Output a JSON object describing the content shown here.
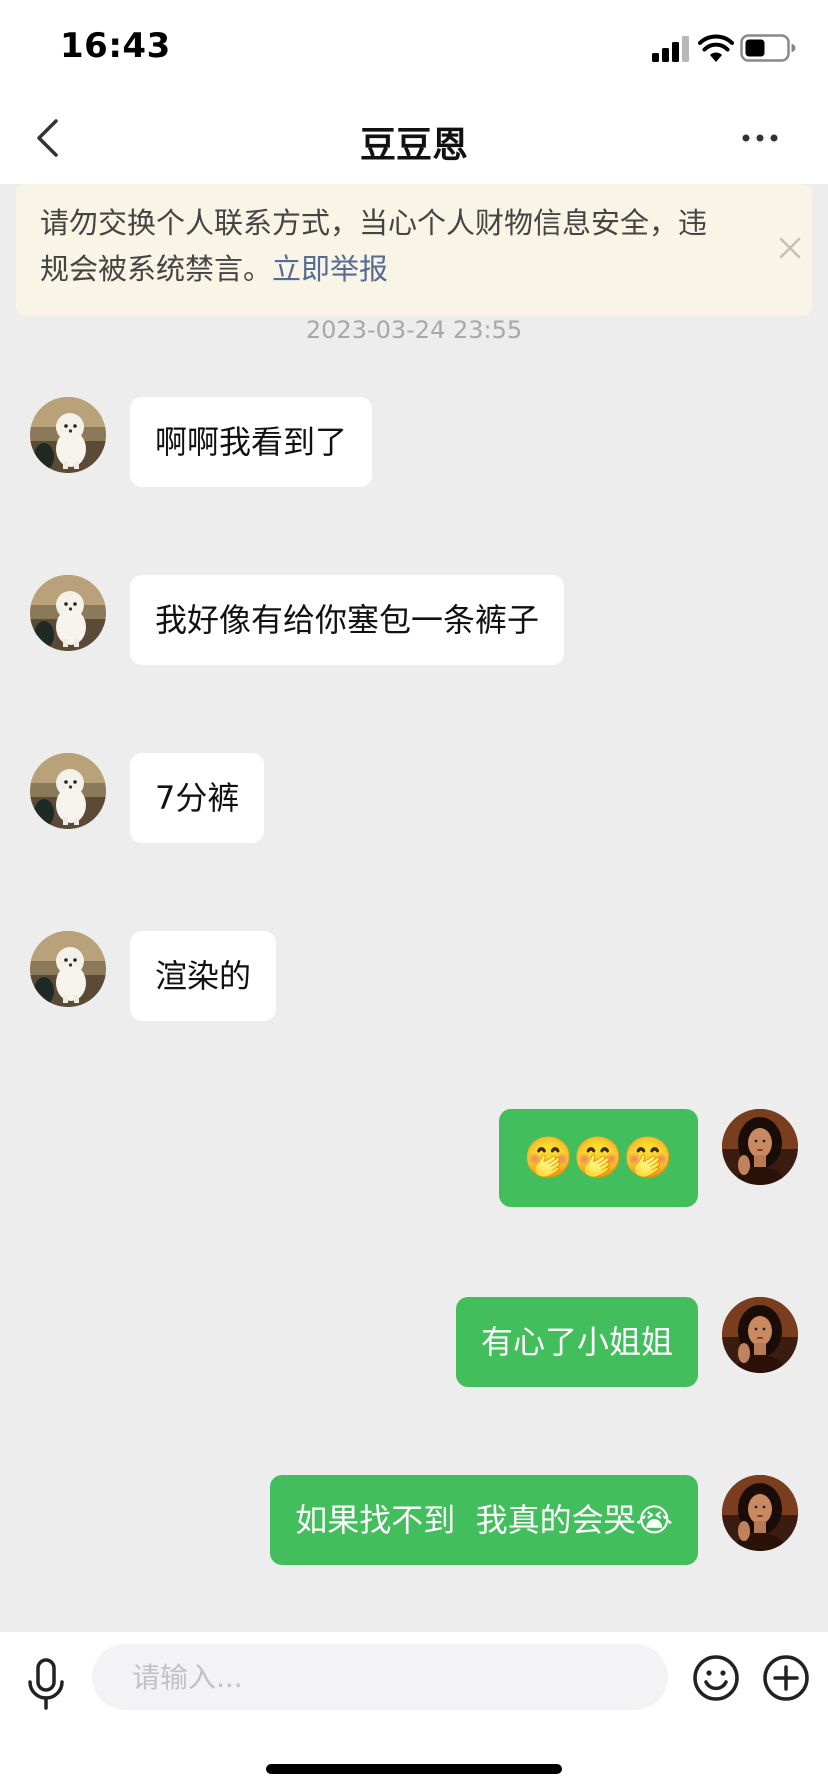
{
  "status_bar": {
    "time": "16:43",
    "icons": [
      "cellular-signal-icon",
      "wifi-icon",
      "battery-icon"
    ]
  },
  "nav": {
    "title": "豆豆恩",
    "back_icon": "chevron-left-icon",
    "more_icon": "more-dots-icon"
  },
  "notice": {
    "text": "请勿交换个人联系方式，当心个人财物信息安全，违规会被系统禁言。",
    "link": "立即举报",
    "close_icon": "close-icon"
  },
  "chat": {
    "timestamp": "2023-03-24 23:55",
    "messages": [
      {
        "from": "other",
        "text": "啊啊我看到了"
      },
      {
        "from": "other",
        "text": "我好像有给你塞包一条裤子"
      },
      {
        "from": "other",
        "text": "7分裤"
      },
      {
        "from": "other",
        "text": "渲染的"
      },
      {
        "from": "me",
        "text": "🤭🤭🤭"
      },
      {
        "from": "me",
        "text": "有心了小姐姐"
      },
      {
        "from": "me",
        "text": "如果找不到  我真的会哭😭"
      }
    ]
  },
  "input_bar": {
    "placeholder": "请输入...",
    "value": "",
    "icons": [
      "microphone-icon",
      "emoji-icon",
      "plus-icon"
    ]
  },
  "colors": {
    "background": "#ededed",
    "outgoing_bubble": "#43be5c",
    "incoming_bubble": "#ffffff",
    "notice_background": "#f8f4e6",
    "link": "#576b95"
  }
}
